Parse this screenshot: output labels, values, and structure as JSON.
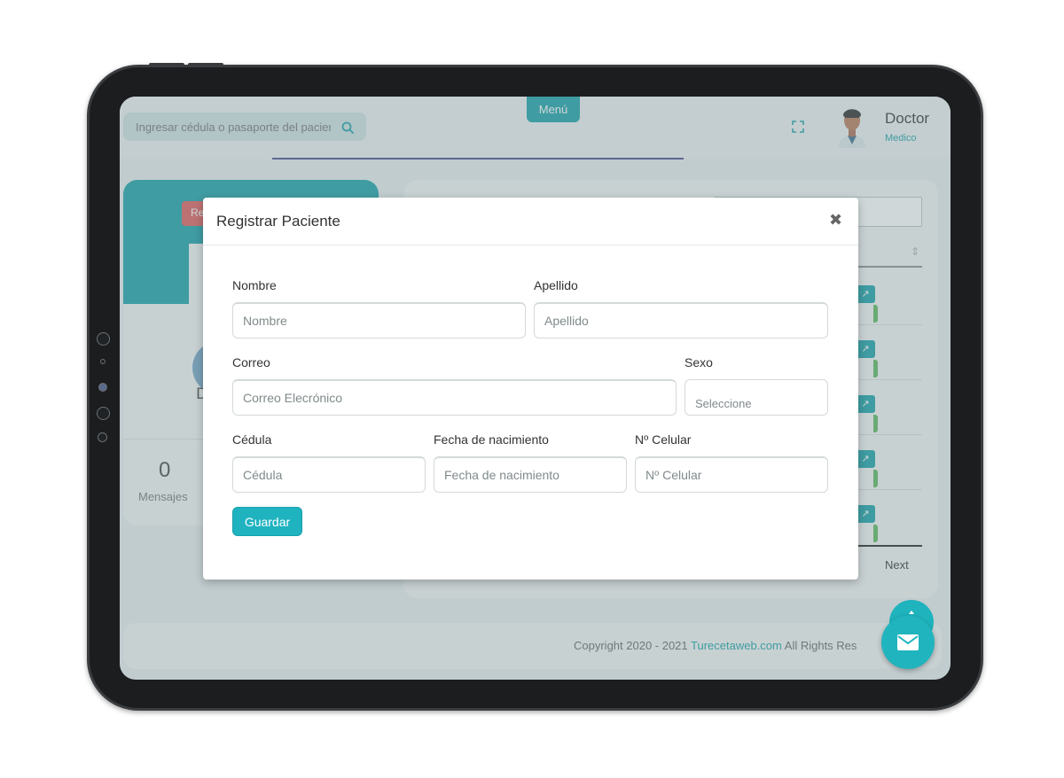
{
  "header": {
    "search_placeholder": "Ingresar cédula o pasaporte del paciente",
    "menu_label": "Menú",
    "user_name": "Doctor",
    "user_role": "Medico"
  },
  "left_card": {
    "button_text": "Re",
    "partial_text": "D",
    "stat_value": "0",
    "stat_label": "Mensajes"
  },
  "table": {
    "next_label": "Next",
    "row_count": 5
  },
  "footer": {
    "copyright": "Copyright 2020 - 2021 ",
    "site_link": "Turecetaweb.com",
    "rights": " All Rights Res"
  },
  "modal": {
    "title": "Registrar Paciente",
    "close_symbol": "✖",
    "fields": {
      "nombre": {
        "label": "Nombre",
        "placeholder": "Nombre"
      },
      "apellido": {
        "label": "Apellido",
        "placeholder": "Apellido"
      },
      "correo": {
        "label": "Correo",
        "placeholder": "Correo Elecrónico"
      },
      "sexo": {
        "label": "Sexo",
        "selected": "Seleccione"
      },
      "cedula": {
        "label": "Cédula",
        "placeholder": "Cédula"
      },
      "fecha": {
        "label": "Fecha de nacimiento",
        "placeholder": "Fecha de nacimiento"
      },
      "celular": {
        "label": "Nº Celular",
        "placeholder": "Nº Celular"
      }
    },
    "save_label": "Guardar"
  },
  "colors": {
    "accent": "#1fb3c0",
    "primary_teal": "#18a0a8",
    "danger": "#e05c5c"
  }
}
